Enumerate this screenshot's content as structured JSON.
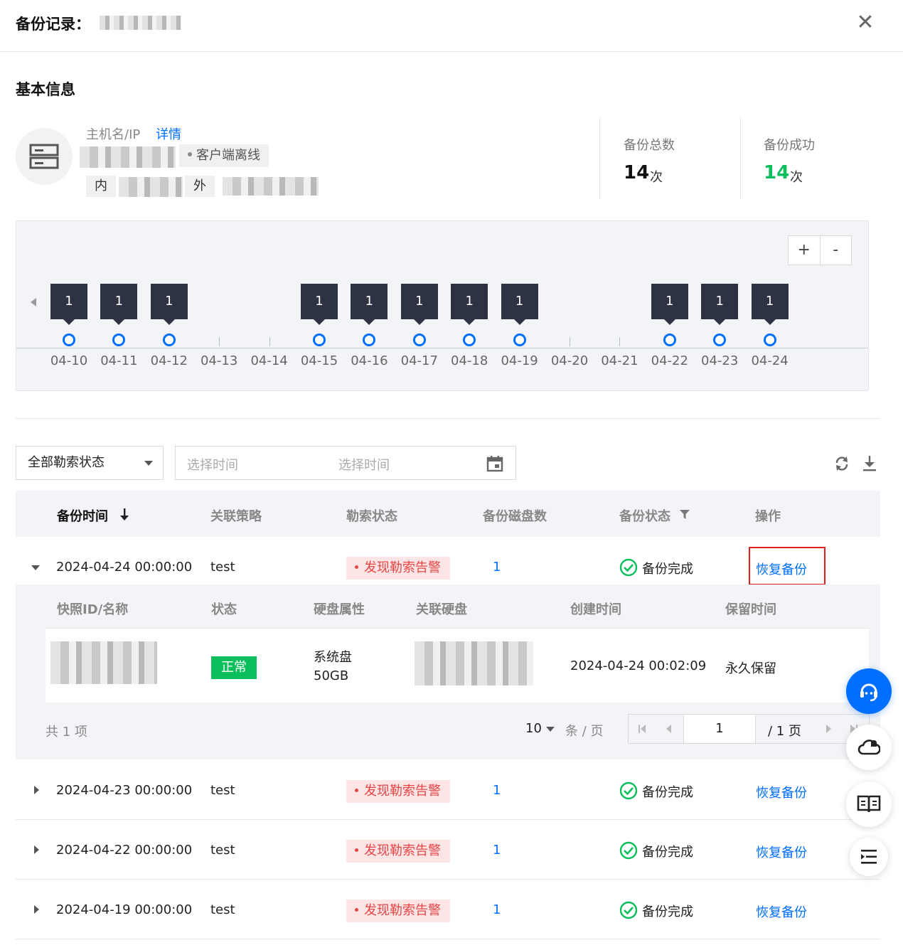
{
  "header": {
    "title": "备份记录：",
    "close_label": "✕"
  },
  "basic_info": {
    "section_title": "基本信息",
    "host_label": "主机名/IP",
    "detail_link": "详情",
    "status_tag": "客户端离线",
    "inner_label": "内",
    "outer_label": "外"
  },
  "stats": {
    "total_label": "备份总数",
    "total_value": "14",
    "total_unit": "次",
    "success_label": "备份成功",
    "success_value": "14",
    "success_unit": "次"
  },
  "timeline": {
    "zoom_in": "+",
    "zoom_out": "-",
    "dates": [
      {
        "label": "04-10",
        "count": "1"
      },
      {
        "label": "04-11",
        "count": "1"
      },
      {
        "label": "04-12",
        "count": "1"
      },
      {
        "label": "04-13",
        "count": ""
      },
      {
        "label": "04-14",
        "count": ""
      },
      {
        "label": "04-15",
        "count": "1"
      },
      {
        "label": "04-16",
        "count": "1"
      },
      {
        "label": "04-17",
        "count": "1"
      },
      {
        "label": "04-18",
        "count": "1"
      },
      {
        "label": "04-19",
        "count": "1"
      },
      {
        "label": "04-20",
        "count": ""
      },
      {
        "label": "04-21",
        "count": ""
      },
      {
        "label": "04-22",
        "count": "1"
      },
      {
        "label": "04-23",
        "count": "1"
      },
      {
        "label": "04-24",
        "count": "1"
      }
    ]
  },
  "filters": {
    "ransom_select": "全部勒索状态",
    "start_placeholder": "选择时间",
    "end_placeholder": "选择时间",
    "refresh_icon": "refresh-icon",
    "download_icon": "download-icon"
  },
  "table": {
    "columns": {
      "backup_time": "备份时间",
      "policy": "关联策略",
      "ransom_status": "勒索状态",
      "disk_count": "备份磁盘数",
      "backup_status": "备份状态",
      "action": "操作"
    },
    "rows": [
      {
        "time": "2024-04-24 00:00:00",
        "policy": "test",
        "ransom": "发现勒索告警",
        "disks": "1",
        "status": "备份完成",
        "action": "恢复备份"
      },
      {
        "time": "2024-04-23 00:00:00",
        "policy": "test",
        "ransom": "发现勒索告警",
        "disks": "1",
        "status": "备份完成",
        "action": "恢复备份"
      },
      {
        "time": "2024-04-22 00:00:00",
        "policy": "test",
        "ransom": "发现勒索告警",
        "disks": "1",
        "status": "备份完成",
        "action": "恢复备份"
      },
      {
        "time": "2024-04-19 00:00:00",
        "policy": "test",
        "ransom": "发现勒索告警",
        "disks": "1",
        "status": "备份完成",
        "action": "恢复备份"
      }
    ]
  },
  "snapshot": {
    "columns": {
      "id_name": "快照ID/名称",
      "state": "状态",
      "disk_attr": "硬盘属性",
      "linked_disk": "关联硬盘",
      "created": "创建时间",
      "retention": "保留时间"
    },
    "row": {
      "state": "正常",
      "disk_type": "系统盘",
      "disk_size": "50GB",
      "created": "2024-04-24 00:02:09",
      "retention": "永久保留"
    },
    "pagination": {
      "total": "共 1 项",
      "page_size": "10",
      "page_size_unit": "条 / 页",
      "current_page": "1",
      "total_pages": "/ 1 页"
    }
  }
}
